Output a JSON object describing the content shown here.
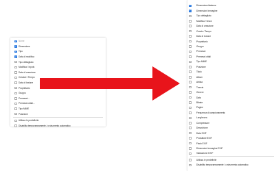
{
  "left_menu": {
    "items": [
      {
        "label": "Nome",
        "checked": true,
        "muted": true
      },
      {
        "label": "Dimensione",
        "checked": true
      },
      {
        "label": "Tipo",
        "checked": true
      },
      {
        "label": "Data di modifica",
        "checked": true
      },
      {
        "label": "Tipo dettagliato",
        "checked": false
      },
      {
        "label": "Modifica / Inputs",
        "checked": false
      },
      {
        "label": "Data di creazione",
        "checked": false
      },
      {
        "label": "Creatori / Tempo",
        "checked": false
      },
      {
        "label": "Data di lezione",
        "checked": false
      },
      {
        "label": "Proprietario",
        "checked": false
      },
      {
        "label": "Gruppo",
        "checked": false
      },
      {
        "label": "Permessi...",
        "checked": false
      },
      {
        "label": "Permessi ottali...",
        "checked": false
      },
      {
        "label": "Tipo MIME",
        "checked": false
      },
      {
        "label": "Posizione",
        "checked": false
      },
      {
        "label": "Utilizza le predefinite",
        "checked": false
      },
      {
        "label": "Disabilita temporaneamente / o strumento automatico",
        "checked": false
      }
    ]
  },
  "right_menu": {
    "items": [
      {
        "label": "Dimensione/sistema",
        "checked": true
      },
      {
        "label": "Dimensioni immagine",
        "checked": true
      },
      {
        "label": "Tipo dettagliato",
        "checked": false
      },
      {
        "label": "Modifica / Snow",
        "checked": false
      },
      {
        "label": "Data di creazione",
        "checked": false
      },
      {
        "label": "Creato / Tempo",
        "checked": false
      },
      {
        "label": "Data di lezione",
        "checked": false
      },
      {
        "label": "Proprietario",
        "checked": false
      },
      {
        "label": "Gruppo",
        "checked": false
      },
      {
        "label": "Permessi",
        "checked": false
      },
      {
        "label": "Permessi ottali",
        "checked": false
      },
      {
        "label": "Tipo MIME",
        "checked": false
      },
      {
        "label": "Posizione",
        "checked": false
      },
      {
        "label": "Titolo",
        "checked": false
      },
      {
        "label": "Album",
        "checked": false
      },
      {
        "label": "Artista",
        "checked": false
      },
      {
        "label": "Traccia",
        "checked": false
      },
      {
        "label": "Genere",
        "checked": false
      },
      {
        "label": "Data",
        "checked": false
      },
      {
        "label": "Bitrate",
        "checked": false
      },
      {
        "label": "Pagine",
        "checked": false
      },
      {
        "label": "Frequenza di campionamento",
        "checked": false
      },
      {
        "label": "Lunghezza",
        "checked": false
      },
      {
        "label": "Compressore",
        "checked": false
      },
      {
        "label": "Descrizione",
        "checked": false
      },
      {
        "label": "Data EXIF",
        "checked": false
      },
      {
        "label": "Produttore EXIF",
        "checked": false
      },
      {
        "label": "Flash EXIF",
        "checked": false
      },
      {
        "label": "Dimensioni immagine EXIF",
        "checked": false
      },
      {
        "label": "Valutazione EXIF",
        "checked": false
      },
      {
        "label": "Utilizza le predefinite",
        "checked": false
      },
      {
        "label": "Disabilita temporaneamente / o strumento automatico",
        "checked": false
      }
    ]
  },
  "colors": {
    "accent": "#2f7de1",
    "arrow": "#e8141b",
    "text": "#222222",
    "muted_text": "#999999"
  }
}
